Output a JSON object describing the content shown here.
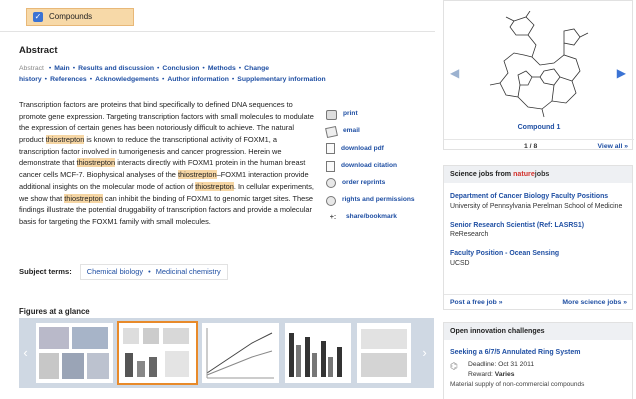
{
  "compounds_tab": {
    "label": "Compounds",
    "checked": true
  },
  "abstract": {
    "heading": "Abstract",
    "nav_prefix": "Abstract",
    "nav": [
      "Main",
      "Results and discussion",
      "Conclusion",
      "Methods",
      "Change history",
      "References",
      "Acknowledgements",
      "Author information",
      "Supplementary information"
    ],
    "segments": [
      {
        "t": "Transcription factors are proteins that bind specifically to defined DNA sequences to promote gene expression. Targeting transcription factors with small molecules to modulate the expression of certain genes has been notoriously difficult to achieve. The natural product "
      },
      {
        "t": "thiostrepton",
        "hl": true
      },
      {
        "t": " is known to reduce the transcriptional activity of FOXM1, a transcription factor involved in tumorigenesis and cancer progression. Herein we demonstrate that "
      },
      {
        "t": "thiostrepton",
        "hl": true
      },
      {
        "t": " interacts directly with FOXM1 protein in the human breast cancer cells MCF-7. Biophysical analyses of the "
      },
      {
        "t": "thiostrepton",
        "hl": true
      },
      {
        "t": "–FOXM1 interaction provide additional insights on the molecular mode of action of "
      },
      {
        "t": "thiostrepton",
        "hl": true
      },
      {
        "t": ". In cellular experiments, we show that "
      },
      {
        "t": "thiostrepton",
        "hl": true
      },
      {
        "t": " can inhibit the binding of FOXM1 to genomic target sites. These findings illustrate the potential druggability of transcription factors and provide a molecular basis for targeting the FOXM1 family with small molecules."
      }
    ]
  },
  "tools": [
    {
      "label": "print",
      "icon": "printer-icon"
    },
    {
      "label": "email",
      "icon": "email-icon"
    },
    {
      "label": "download pdf",
      "icon": "pdf-icon"
    },
    {
      "label": "download citation",
      "icon": "citation-icon"
    },
    {
      "label": "order reprints",
      "icon": "reprints-icon"
    },
    {
      "label": "rights and permissions",
      "icon": "permissions-icon"
    },
    {
      "label": "share/bookmark",
      "icon": "share-icon"
    }
  ],
  "subject_terms": {
    "label": "Subject terms:",
    "terms": [
      "Chemical biology",
      "Medicinal chemistry"
    ]
  },
  "figures": {
    "heading": "Figures at a glance",
    "count": 5
  },
  "compound_card": {
    "name": "Compound 1",
    "counter": "1 / 8",
    "view_all": "View all »"
  },
  "jobs": {
    "heading_prefix": "Science jobs from ",
    "brand_a": "nature",
    "brand_b": "jobs",
    "items": [
      {
        "title": "Department of Cancer Biology Faculty Positions",
        "org": "University of Pennsylvania Perelman School of Medicine"
      },
      {
        "title": "Senior Research Scientist (Ref: LASRS1)",
        "org": "ReResearch"
      },
      {
        "title": "Faculty Position - Ocean Sensing",
        "org": "UCSD"
      }
    ],
    "post_link": "Post a free job »",
    "more_link": "More science jobs »"
  },
  "innovation": {
    "heading": "Open innovation challenges",
    "title": "Seeking a 6/7/5 Annulated Ring System",
    "deadline": "Deadline: Oct 31 2011",
    "reward_label": "Reward: ",
    "reward_value": "Varies",
    "desc": "Material supply of non-commercial compounds"
  },
  "colors": {
    "accent_link": "#1f4fa3",
    "highlight": "#f6d6a4",
    "figure_strip": "#cfd8e3",
    "brand_red": "#d2322d"
  }
}
